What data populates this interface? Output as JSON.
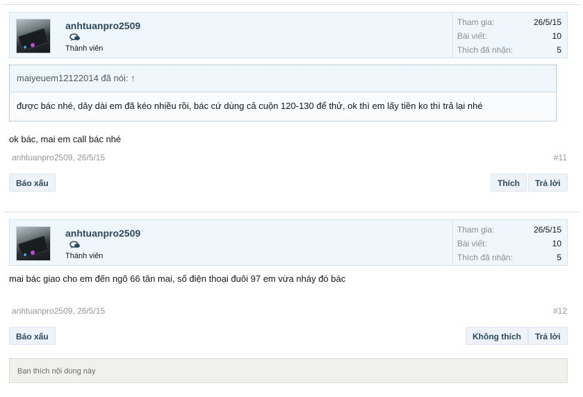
{
  "posts": [
    {
      "author": "anhtuanpro2509",
      "user_title": "Thành viên",
      "stats": [
        {
          "label": "Tham gia:",
          "value": "26/5/15"
        },
        {
          "label": "Bài viết:",
          "value": "10"
        },
        {
          "label": "Thích đã nhận:",
          "value": "5"
        }
      ],
      "quote": {
        "header": "maiyeuem12122014 đã nói: ↑",
        "text": "được bác nhé, dây dài em đã kéo nhiều rồi, bác cứ dùng cả cuộn 120-130 để thử, ok thì em lấy tiền ko thì trả lại nhé"
      },
      "message": "ok bác, mai em call bác nhé",
      "meta": "anhtuanpro2509, 26/5/15",
      "permalink": "#11",
      "report_label": "Báo xấu",
      "like_label": "Thích",
      "reply_label": "Trả lời"
    },
    {
      "author": "anhtuanpro2509",
      "user_title": "Thành viên",
      "stats": [
        {
          "label": "Tham gia:",
          "value": "26/5/15"
        },
        {
          "label": "Bài viết:",
          "value": "10"
        },
        {
          "label": "Thích đã nhận:",
          "value": "5"
        }
      ],
      "message": "mai bác giao cho em đến ngõ 66 tân mai, số điện thoại đuôi 97 em vừa nháy đó bác",
      "meta": "anhtuanpro2509, 26/5/15",
      "permalink": "#12",
      "report_label": "Báo xấu",
      "unlike_label": "Không thích",
      "reply_label": "Trả lời",
      "likes_summary": "Bạn thích nội dung này"
    }
  ],
  "icons": {
    "avatar": "user-avatar",
    "conversation": "chat-bubble-icon"
  },
  "colors": {
    "link": "#2b485c",
    "panel": "#f0f7fc",
    "border": "#d7e3ee",
    "muted": "#969696"
  }
}
